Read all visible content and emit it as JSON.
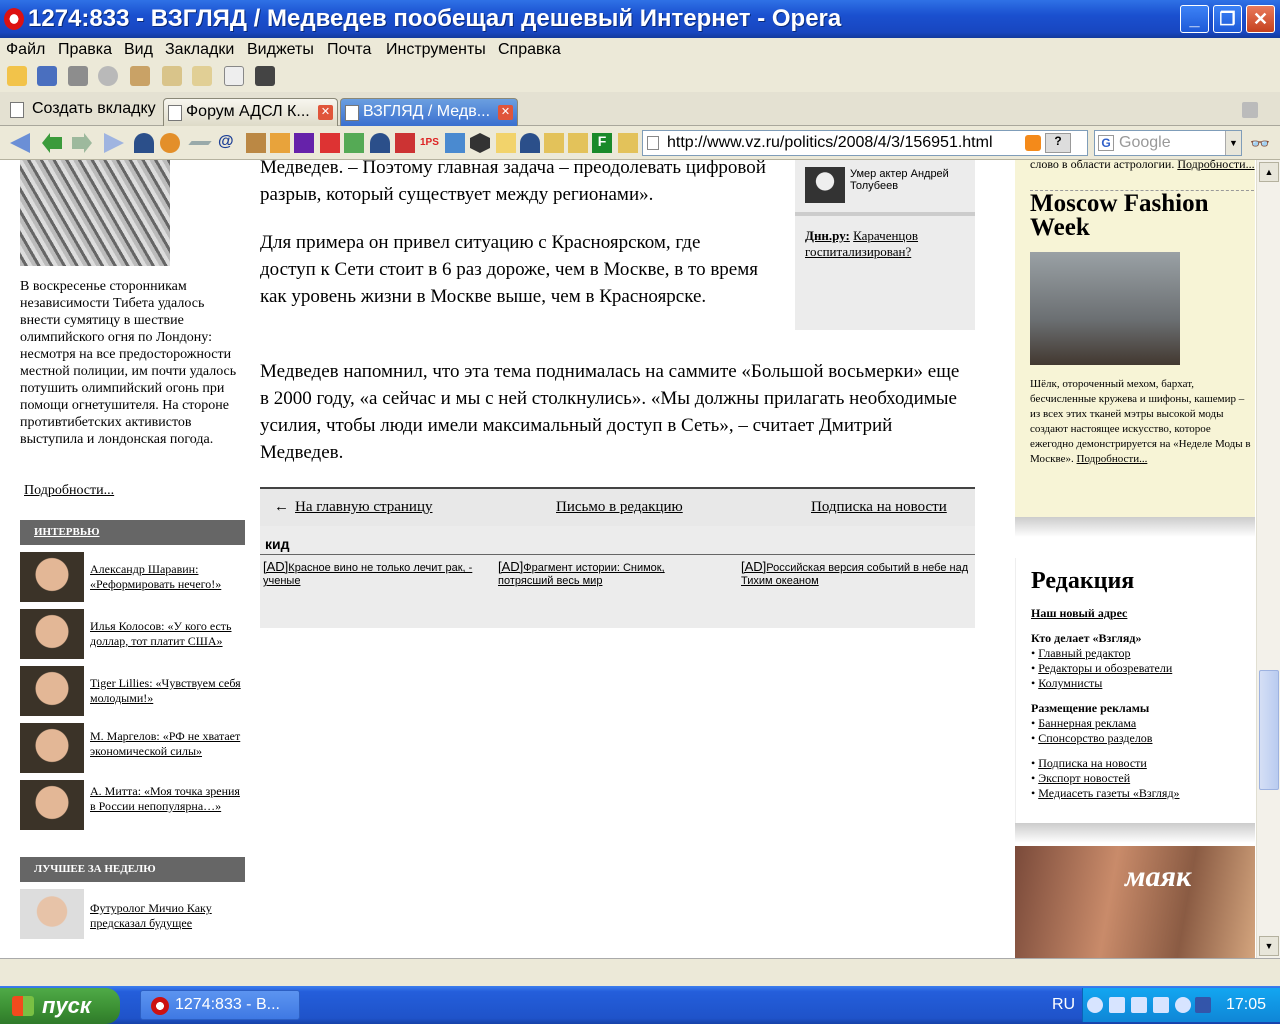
{
  "window": {
    "title": "1274:833 - ВЗГЛЯД / Медведев пообещал дешевый Интернет - Opera",
    "min": "_",
    "max": "❐",
    "close": "✕"
  },
  "menu": [
    "Файл",
    "Правка",
    "Вид",
    "Закладки",
    "Виджеты",
    "Почта",
    "Инструменты",
    "Справка"
  ],
  "tabs": {
    "new_tab": "Создать вкладку",
    "items": [
      {
        "label": "Форум АДСЛ К..."
      },
      {
        "label": "ВЗГЛЯД / Медв..."
      }
    ]
  },
  "address": {
    "url": "http://www.vz.ru/politics/2008/4/3/156951.html",
    "help": "?"
  },
  "search": {
    "placeholder": "Google",
    "engine_glyph": "G"
  },
  "left": {
    "caption": "В воскресенье сторонникам независимости Тибета удалось внести сумятицу в шествие олимпийского огня по Лондону: несмотря на все предосторожности местной полиции, им почти удалось потушить олимпийский огонь при помощи огнетушителя. На стороне противтибетских активистов выступила и лондонская погода.",
    "more": "Подробности...",
    "interview_head": "ИНТЕРВЬЮ",
    "interviews": [
      "Александр Шаравин: «Реформировать нечего!»",
      "Илья Колосов: «У кого есть доллар, тот платит США»",
      "Tiger Lillies: «Чувствуем себя молодыми!»",
      "М. Маргелов: «РФ не хватает экономической силы»",
      "А. Митта: «Моя точка зрения в России непопулярна…»"
    ],
    "best_head": "ЛУЧШЕЕ ЗА НЕДЕЛЮ",
    "best": [
      "Футуролог Мичио Каку предсказал будущее"
    ]
  },
  "article": {
    "p1": "Медведев. – Поэтому главная задача – преодолевать цифровой разрыв, который существует между регионами».",
    "p2": "Для примера он привел ситуацию с Красноярском, где доступ к Сети стоит в 6 раз дороже, чем в Москве, в то время как уровень жизни в Москве выше, чем в Красноярске.",
    "p3": "Медведев напомнил, что эта тема поднималась на саммите «Большой восьмерки» еще в 2000 году, «а сейчас и мы с ней столкнулись». «Мы должны прилагать необходимые усилия, чтобы люди имели максимальный доступ в Сеть», – считает Дмитрий Медведев."
  },
  "sidebox": {
    "news1": "Умер актер Андрей Толубеев",
    "source2": "Днн.ру:",
    "news2": "Караченцов госпитализирован?"
  },
  "bottom_nav": {
    "arrow": "←",
    "home": "На главную страницу",
    "letter": "Письмо в редакцию",
    "subscribe": "Подписка на новости"
  },
  "ads": {
    "head": "кид",
    "items": [
      {
        "tag": "[AD]",
        "text": "Красное вино не только лечит рак, - ученые"
      },
      {
        "tag": "[AD]",
        "text": "Фрагмент истории: Снимок, потрясший весь мир"
      },
      {
        "tag": "[AD]",
        "text": "Российская версия событий в небе над Тихим океаном"
      }
    ]
  },
  "fashion": {
    "top_text": "слово в области астрологии.",
    "top_more": "Подробности...",
    "title": "Moscow Fashion Week",
    "text": "Шёлк, отороченный мехом, бархат, бесчисленные кружева и шифоны, кашемир – из всех этих тканей мэтры высокой моды создают настоящее искусство, которое ежегодно демонстрируется на «Неделе Моды в Москве».",
    "more": "Подробности..."
  },
  "redakcia": {
    "title": "Редакция",
    "new_address": "Наш новый адрес",
    "who_head": "Кто делает «Взгляд»",
    "who": [
      "Главный редактор",
      "Редакторы и обозреватели",
      "Колумнисты"
    ],
    "ads_head": "Размещение рекламы",
    "ads": [
      "Баннерная реклама",
      "Спонсорство разделов"
    ],
    "misc": [
      "Подписка на новости",
      "Экспорт новостей",
      "Медиасеть газеты «Взгляд»"
    ]
  },
  "promo": {
    "brand": "маяк"
  },
  "taskbar": {
    "start": "пуск",
    "task": "1274:833 - В...",
    "lang": "RU",
    "clock": "17:05"
  }
}
